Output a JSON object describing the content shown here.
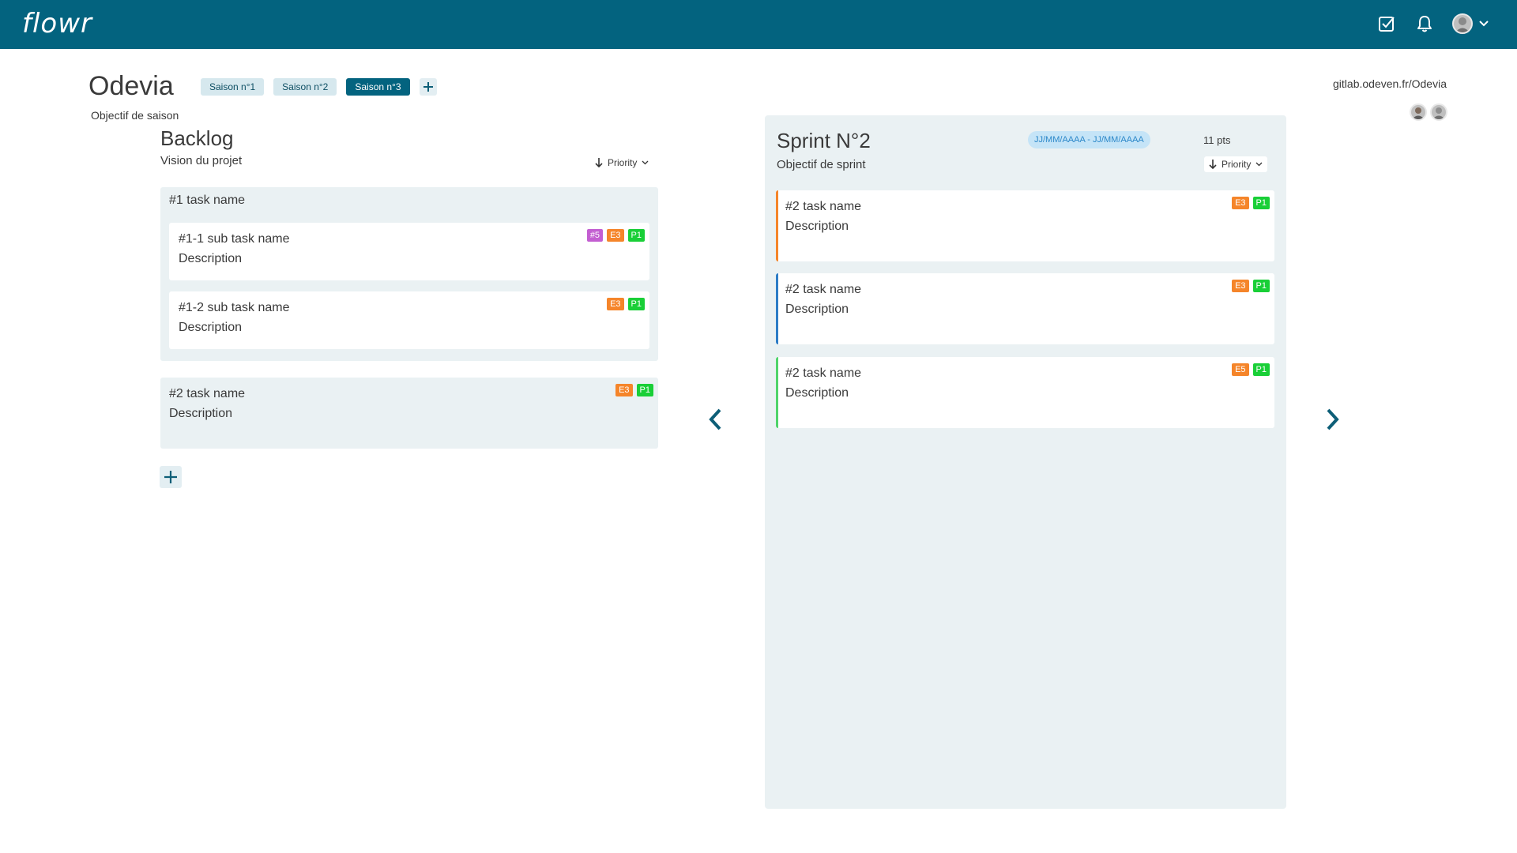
{
  "app": {
    "logo": "flowr",
    "colors": {
      "brand": "#03637f",
      "panel": "#eaf1f3",
      "orange": "#f5852a",
      "green": "#19cf37",
      "purple": "#c35ed1",
      "blue": "#2c7cc6"
    }
  },
  "topbar": {
    "icons": [
      "checkbox-icon",
      "bell-icon",
      "user-avatar",
      "chevron-down-icon"
    ]
  },
  "header": {
    "project_title": "Odevia",
    "season_goal": "Objectif de saison",
    "git_link": "gitlab.odeven.fr/Odevia",
    "seasons": [
      {
        "label": "Saison n°1",
        "active": false
      },
      {
        "label": "Saison n°2",
        "active": false
      },
      {
        "label": "Saison n°3",
        "active": true
      }
    ]
  },
  "backlog": {
    "title": "Backlog",
    "subtitle": "Vision du projet",
    "sort_label": "Priority",
    "groups": [
      {
        "title": "#1 task name",
        "subtasks": [
          {
            "title": "#1-1 sub task name",
            "description": "Description",
            "badges": [
              "#5",
              "E3",
              "P1"
            ]
          },
          {
            "title": "#1-2 sub task name",
            "description": "Description",
            "badges": [
              "E3",
              "P1"
            ]
          }
        ]
      }
    ],
    "tasks": [
      {
        "title": "#2 task name",
        "description": "Description",
        "badges": [
          "E3",
          "P1"
        ]
      }
    ]
  },
  "sprint": {
    "title": "Sprint N°2",
    "subtitle": "Objectif de sprint",
    "dates": "JJ/MM/AAAA - JJ/MM/AAAA",
    "points": "11 pts",
    "sort_label": "Priority",
    "cards": [
      {
        "title": "#2 task name",
        "description": "Description",
        "badges": [
          "E3",
          "P1"
        ],
        "accent": "#f5852a"
      },
      {
        "title": "#2 task name",
        "description": "Description",
        "badges": [
          "E3",
          "P1"
        ],
        "accent": "#2c7cc6"
      },
      {
        "title": "#2 task name",
        "description": "Description",
        "badges": [
          "E5",
          "P1"
        ],
        "accent": "#4fd46a"
      }
    ]
  }
}
